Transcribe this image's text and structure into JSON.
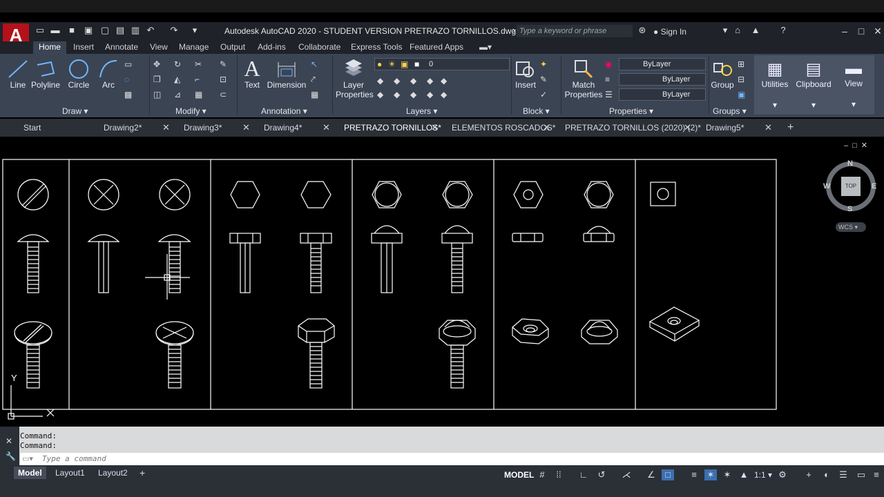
{
  "window": {
    "title": "Autodesk AutoCAD 2020 - STUDENT VERSION    PRETRAZO TORNILLOS.dwg",
    "app_logo": "A",
    "search_placeholder": "Type a keyword or phrase",
    "sign_in": "Sign In"
  },
  "ribbon_tabs": [
    "Home",
    "Insert",
    "Annotate",
    "View",
    "Manage",
    "Output",
    "Add-ins",
    "Collaborate",
    "Express Tools",
    "Featured Apps"
  ],
  "ribbon": {
    "draw": {
      "title": "Draw",
      "line": "Line",
      "polyline": "Polyline",
      "circle": "Circle",
      "arc": "Arc"
    },
    "modify": {
      "title": "Modify"
    },
    "annotation": {
      "title": "Annotation",
      "text": "Text",
      "dimension": "Dimension"
    },
    "layers": {
      "title": "Layers",
      "layer_properties": "Layer Properties",
      "current_layer": "0"
    },
    "block": {
      "title": "Block",
      "insert": "Insert"
    },
    "properties": {
      "title": "Properties",
      "match_properties": "Match Properties",
      "color": "ByLayer",
      "linetype": "ByLayer",
      "lineweight": "ByLayer"
    },
    "groups": {
      "title": "Groups",
      "group": "Group"
    },
    "utilities": "Utilities",
    "clipboard": "Clipboard",
    "view": "View"
  },
  "doc_tabs": [
    "Start",
    "Drawing2*",
    "Drawing3*",
    "Drawing4*",
    "PRETRAZO TORNILLOS*",
    "ELEMENTOS ROSCADOS*",
    "PRETRAZO TORNILLOS (2020) (2)*",
    "Drawing5*"
  ],
  "viewcube": {
    "n": "N",
    "s": "S",
    "e": "E",
    "w": "W",
    "top": "TOP",
    "wcs": "WCS"
  },
  "ucs": {
    "y": "Y"
  },
  "command": {
    "line1": "Command:",
    "line2": "Command:",
    "placeholder": "Type a command"
  },
  "layout_tabs": [
    "Model",
    "Layout1",
    "Layout2"
  ],
  "status": {
    "model": "MODEL",
    "scale": "1:1"
  },
  "colors": {
    "accent": "#3b4453",
    "logo": "#b3121a",
    "drawing_line": "#ffffff"
  }
}
